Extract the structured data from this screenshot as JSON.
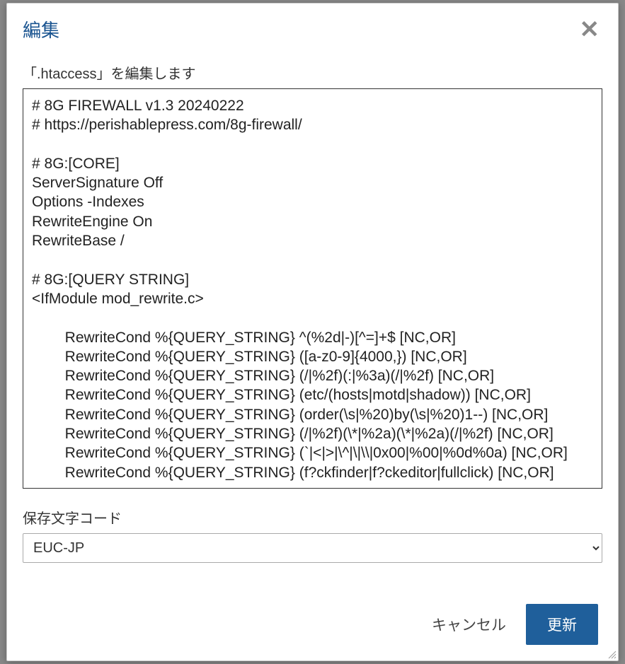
{
  "modal": {
    "title": "編集",
    "description": "「.htaccess」を編集します",
    "editor_content": "# 8G FIREWALL v1.3 20240222\n# https://perishablepress.com/8g-firewall/\n\n# 8G:[CORE]\nServerSignature Off\nOptions -Indexes\nRewriteEngine On\nRewriteBase /\n\n# 8G:[QUERY STRING]\n<IfModule mod_rewrite.c>\n\n        RewriteCond %{QUERY_STRING} ^(%2d|-)[^=]+$ [NC,OR]\n        RewriteCond %{QUERY_STRING} ([a-z0-9]{4000,}) [NC,OR]\n        RewriteCond %{QUERY_STRING} (/|%2f)(:|%3a)(/|%2f) [NC,OR]\n        RewriteCond %{QUERY_STRING} (etc/(hosts|motd|shadow)) [NC,OR]\n        RewriteCond %{QUERY_STRING} (order(\\s|%20)by(\\s|%20)1--) [NC,OR]\n        RewriteCond %{QUERY_STRING} (/|%2f)(\\*|%2a)(\\*|%2a)(/|%2f) [NC,OR]\n        RewriteCond %{QUERY_STRING} (`|<|>|\\^|\\|\\\\|0x00|%00|%0d%0a) [NC,OR]\n        RewriteCond %{QUERY_STRING} (f?ckfinder|f?ckeditor|fullclick) [NC,OR]",
    "encoding_label": "保存文字コード",
    "encoding_value": "EUC-JP",
    "cancel_label": "キャンセル",
    "submit_label": "更新"
  }
}
